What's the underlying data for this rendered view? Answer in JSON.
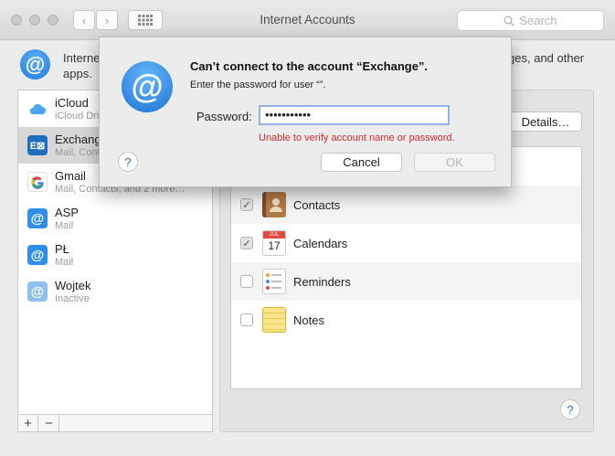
{
  "window": {
    "title": "Internet Accounts",
    "search_placeholder": "Search",
    "back_glyph": "‹",
    "forward_glyph": "›"
  },
  "header": {
    "icon": "at-sign-icon",
    "text": "Internet Accounts sets up your accounts to use with Mail, Contacts, Calendar, Messages, and other apps."
  },
  "sidebar": {
    "accounts": [
      {
        "name": "iCloud",
        "subtitle": "iCloud Drive",
        "icon": "icloud-icon",
        "color": "#4aa4f0"
      },
      {
        "name": "Exchange",
        "subtitle": "Mail, Contacts",
        "icon": "exchange-icon",
        "color": "#1f6fc1"
      },
      {
        "name": "Gmail",
        "subtitle": "Mail, Contacts, and 2 more…",
        "icon": "google-icon",
        "color": "#ffffff"
      },
      {
        "name": "ASP",
        "subtitle": "Mail",
        "icon": "at-sign-icon",
        "color": "#2e8fe6"
      },
      {
        "name": "PŁ",
        "subtitle": "Mail",
        "icon": "at-sign-icon",
        "color": "#2e8fe6"
      },
      {
        "name": "Wojtek",
        "subtitle": "Inactive",
        "icon": "at-sign-icon",
        "color": "#8cc1ef"
      }
    ],
    "add_label": "+",
    "remove_label": "−"
  },
  "details": {
    "button_label": "Details…",
    "services": [
      {
        "label": "",
        "checked": false,
        "icon": ""
      },
      {
        "label": "Contacts",
        "checked": true,
        "icon": "contacts-icon"
      },
      {
        "label": "Calendars",
        "checked": true,
        "icon": "calendar-icon"
      },
      {
        "label": "Reminders",
        "checked": false,
        "icon": "reminders-icon"
      },
      {
        "label": "Notes",
        "checked": false,
        "icon": "notes-icon"
      }
    ],
    "calendar_month": "JUL",
    "calendar_day": "17",
    "help_label": "?"
  },
  "dialog": {
    "title": "Can’t connect to the account “Exchange”.",
    "subtitle": "Enter the password for user “”.",
    "password_label": "Password:",
    "password_value": "•••••••••••",
    "error": "Unable to verify account name or password.",
    "cancel_label": "Cancel",
    "ok_label": "OK",
    "help_label": "?"
  },
  "colors": {
    "accent": "#1d6fd6",
    "error": "#d12b2b",
    "focus_ring": "#8fb4e8"
  }
}
